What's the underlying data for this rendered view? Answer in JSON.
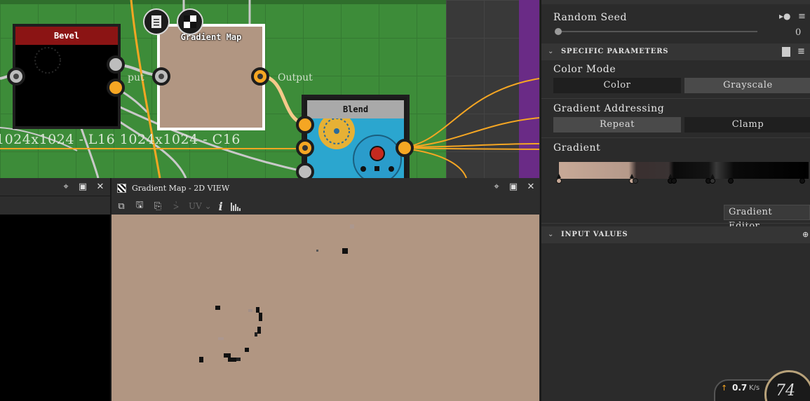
{
  "graph": {
    "nodes": {
      "bevel": {
        "title": "Bevel",
        "color": "#8b1414"
      },
      "gradient_map": {
        "title": "Gradient Map",
        "output_label": "Output"
      },
      "blend": {
        "title": "Blend"
      }
    },
    "partial_output_label": "put",
    "resolution_text": "1024x1024 - L16 1024x1024 - C16"
  },
  "view2d": {
    "title": "Gradient Map - 2D VIEW",
    "toolbar": {
      "uv_label": "UV",
      "info_label": "i"
    }
  },
  "props": {
    "random_seed": {
      "label": "Random Seed",
      "value": "0"
    },
    "specific_parameters": {
      "header": "SPECIFIC PARAMETERS"
    },
    "color_mode": {
      "label": "Color Mode",
      "options": [
        "Color",
        "Grayscale"
      ],
      "selected": "Grayscale"
    },
    "gradient_addressing": {
      "label": "Gradient Addressing",
      "options": [
        "Repeat",
        "Clamp"
      ],
      "selected": "Repeat"
    },
    "gradient": {
      "label": "Gradient",
      "editor_button": "Gradient Editor"
    },
    "input_values": {
      "header": "INPUT VALUES"
    }
  },
  "status": {
    "speed": "0.7",
    "speed_unit": "K/s",
    "percent": "74"
  },
  "colors": {
    "accent_orange": "#f5a623",
    "graph_green": "#3d8c39",
    "preview_fill": "#b19682"
  }
}
